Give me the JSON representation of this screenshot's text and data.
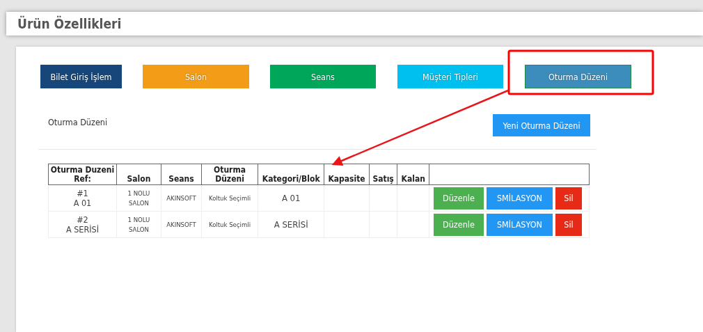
{
  "page_title": "Ürün Özellikleri",
  "tabs": [
    {
      "label": "Bilet Giriş İşlem",
      "color": "#17477a",
      "selected": false
    },
    {
      "label": "Salon",
      "color": "#f39c18",
      "selected": false
    },
    {
      "label": "Seans",
      "color": "#00a65a",
      "selected": false
    },
    {
      "label": "Müşteri Tipleri",
      "color": "#00c0ef",
      "selected": false
    },
    {
      "label": "Oturma Düzeni",
      "color": "#3c8dbc",
      "selected": true
    }
  ],
  "section_title": "Oturma Düzeni",
  "new_button": "Yeni Oturma Düzeni",
  "table": {
    "columns": [
      "Oturma Duzeni Ref:",
      "Salon",
      "Seans",
      "Oturma Düzeni",
      "Kategori/Blok",
      "Kapasite",
      "Satış",
      "Kalan"
    ],
    "rows": [
      {
        "ref_number": "#1",
        "ref_name": "A 01",
        "salon": "1 NOLU SALON",
        "seans": "AKINSOFT",
        "oturma": "Koltuk Seçimli",
        "kategori": "A 01",
        "actions": [
          "Düzenle",
          "SMİLASYON",
          "Sil"
        ]
      },
      {
        "ref_number": "#2",
        "ref_name": "A SERİSİ",
        "salon": "1 NOLU SALON",
        "seans": "AKINSOFT",
        "oturma": "Koltuk Seçimli",
        "kategori": "A SERİSİ",
        "actions": [
          "Düzenle",
          "SMİLASYON",
          "Sil"
        ]
      }
    ]
  }
}
